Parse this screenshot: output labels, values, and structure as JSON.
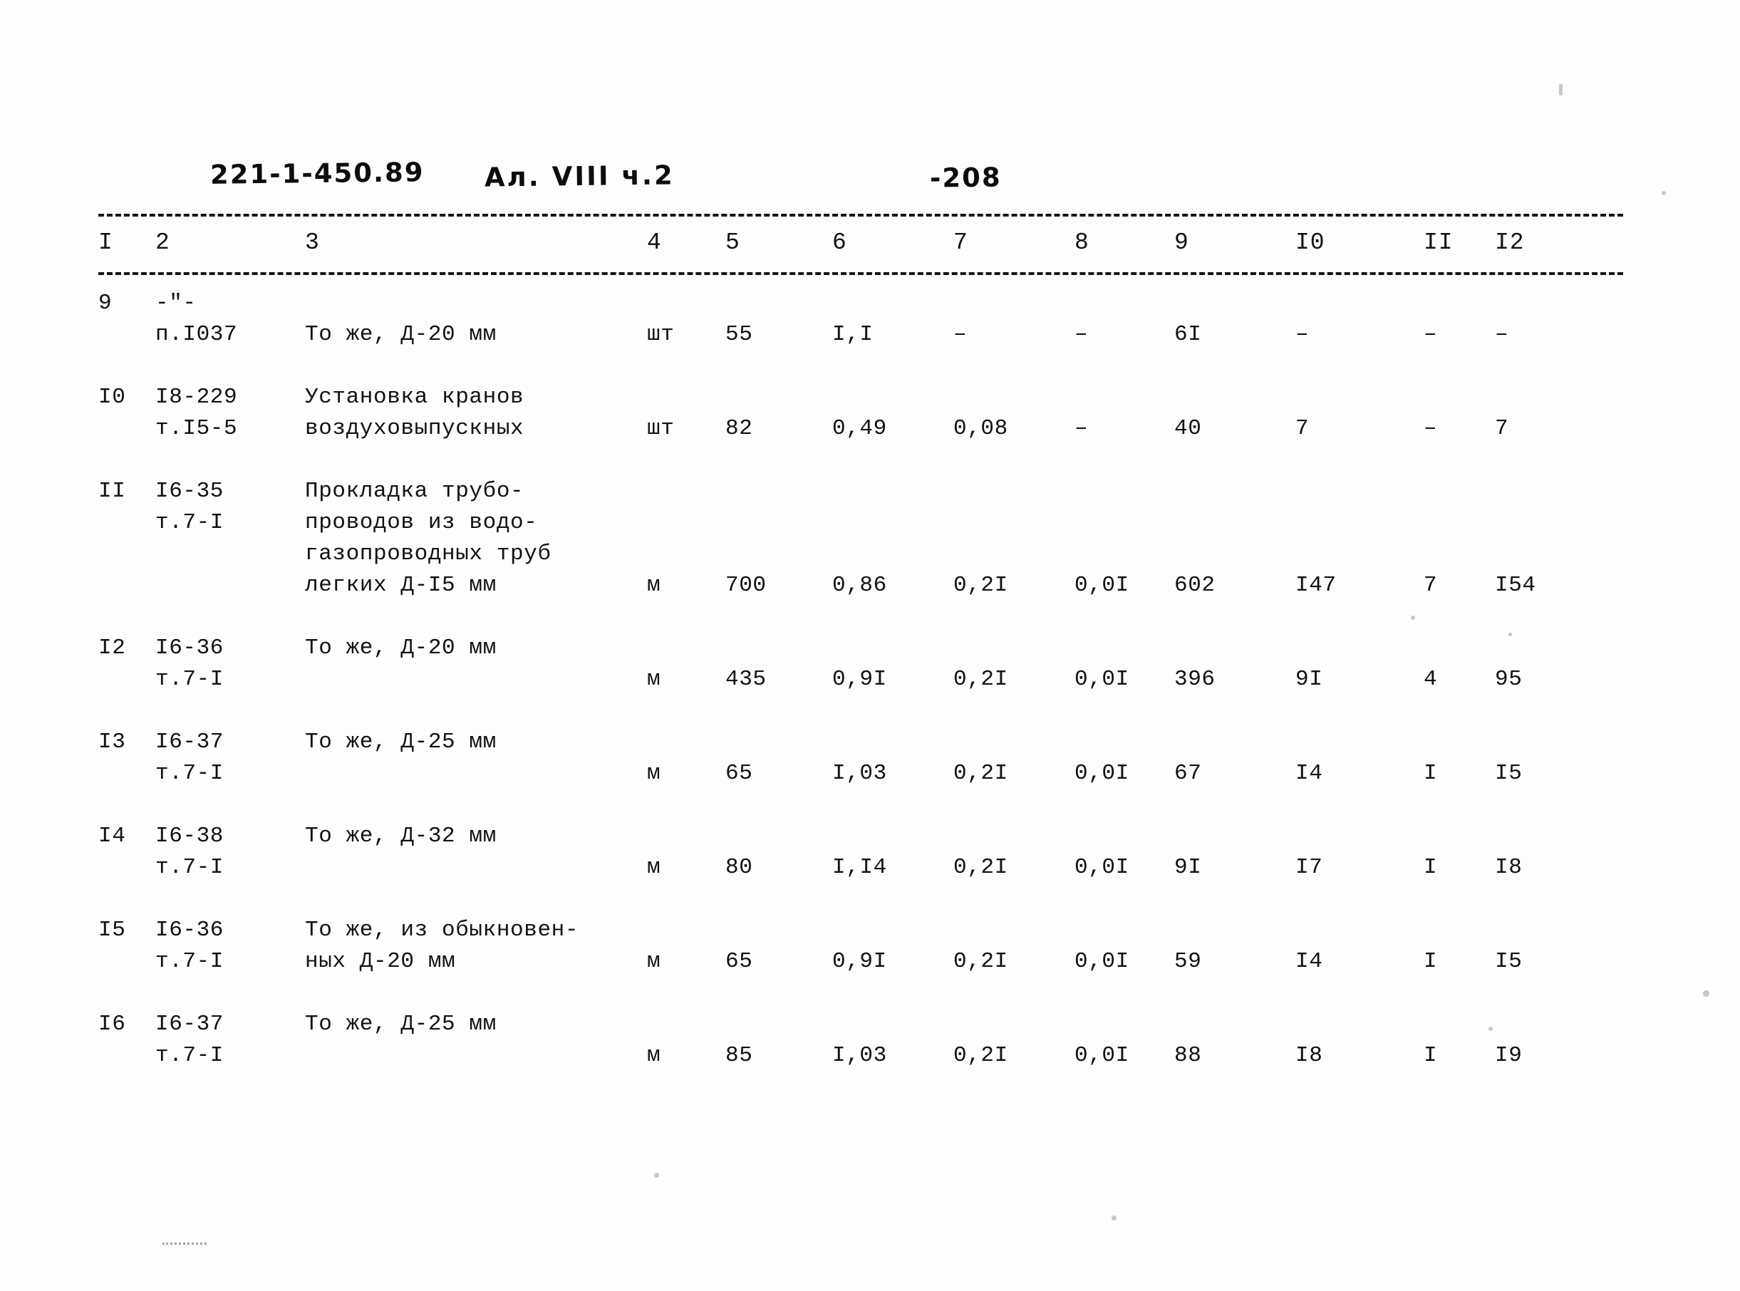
{
  "header": {
    "project_code": "221-1-450.89",
    "album": "Ал. VIII ч.2",
    "page_number": "-208"
  },
  "table": {
    "column_headers": [
      "I",
      "2",
      "3",
      "4",
      "5",
      "6",
      "7",
      "8",
      "9",
      "I0",
      "II",
      "I2"
    ],
    "rows": [
      {
        "num": "9",
        "code": "-\"-\nп.I037",
        "description": "То же, Д-20 мм",
        "unit": "шт",
        "qty": "55",
        "c6": "I,I",
        "c7": "–",
        "c8": "–",
        "c9": "6I",
        "c10": "–",
        "c11": "–",
        "c12": "–"
      },
      {
        "num": "I0",
        "code": "I8-229\nт.I5-5",
        "description": "Установка кранов\nвоздуховыпускных",
        "unit": "шт",
        "qty": "82",
        "c6": "0,49",
        "c7": "0,08",
        "c8": "–",
        "c9": "40",
        "c10": "7",
        "c11": "–",
        "c12": "7"
      },
      {
        "num": "II",
        "code": "I6-35\nт.7-I",
        "description": "Прокладка трубо-\nпроводов из водо-\nгазопроводных труб\nлегких Д-I5 мм",
        "unit": "м",
        "qty": "700",
        "c6": "0,86",
        "c7": "0,2I",
        "c8": "0,0I",
        "c9": "602",
        "c10": "I47",
        "c11": "7",
        "c12": "I54"
      },
      {
        "num": "I2",
        "code": "I6-36\nт.7-I",
        "description": "То же, Д-20 мм",
        "unit": "м",
        "qty": "435",
        "c6": "0,9I",
        "c7": "0,2I",
        "c8": "0,0I",
        "c9": "396",
        "c10": "9I",
        "c11": "4",
        "c12": "95"
      },
      {
        "num": "I3",
        "code": "I6-37\nт.7-I",
        "description": "То же, Д-25 мм",
        "unit": "м",
        "qty": "65",
        "c6": "I,03",
        "c7": "0,2I",
        "c8": "0,0I",
        "c9": "67",
        "c10": "I4",
        "c11": "I",
        "c12": "I5"
      },
      {
        "num": "I4",
        "code": "I6-38\nт.7-I",
        "description": "То же, Д-32 мм",
        "unit": "м",
        "qty": "80",
        "c6": "I,I4",
        "c7": "0,2I",
        "c8": "0,0I",
        "c9": "9I",
        "c10": "I7",
        "c11": "I",
        "c12": "I8"
      },
      {
        "num": "I5",
        "code": "I6-36\nт.7-I",
        "description": "То же, из обыкновен-\nных Д-20 мм",
        "unit": "м",
        "qty": "65",
        "c6": "0,9I",
        "c7": "0,2I",
        "c8": "0,0I",
        "c9": "59",
        "c10": "I4",
        "c11": "I",
        "c12": "I5"
      },
      {
        "num": "I6",
        "code": "I6-37\nт.7-I",
        "description": "То же, Д-25 мм",
        "unit": "м",
        "qty": "85",
        "c6": "I,03",
        "c7": "0,2I",
        "c8": "0,0I",
        "c9": "88",
        "c10": "I8",
        "c11": "I",
        "c12": "I9"
      }
    ]
  }
}
